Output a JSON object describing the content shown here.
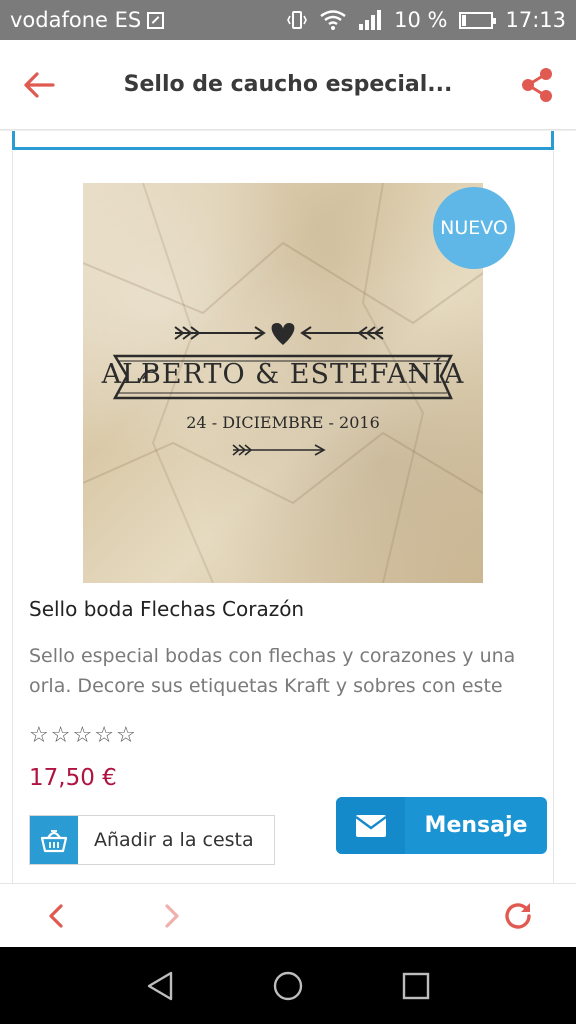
{
  "status_bar": {
    "carrier": "vodafone ES",
    "battery": "10 %",
    "time": "17:13"
  },
  "app_bar": {
    "title": "Sello de caucho especial...",
    "back_icon": "arrow-left-icon",
    "share_icon": "share-icon"
  },
  "product": {
    "badge": "NUEVO",
    "stamp_name": "ALBERTO & ESTEFANÍA",
    "stamp_date": "24 - DICIEMBRE - 2016",
    "title": "Sello boda Flechas Corazón",
    "description": "Sello especial bodas con flechas y corazones y una orla. Decore sus etiquetas Kraft y sobres con este",
    "rating": 0,
    "rating_max": 5,
    "price": "17,50 €",
    "add_to_cart_label": "Añadir a la cesta",
    "message_label": "Mensaje"
  },
  "colors": {
    "accent_red": "#e05a52",
    "accent_blue": "#1b94d4",
    "price": "#b0133f",
    "badge": "#5eb7e6"
  },
  "browser_bar": {
    "back_icon": "chevron-left-icon",
    "forward_icon": "chevron-right-icon",
    "reload_icon": "reload-icon"
  }
}
